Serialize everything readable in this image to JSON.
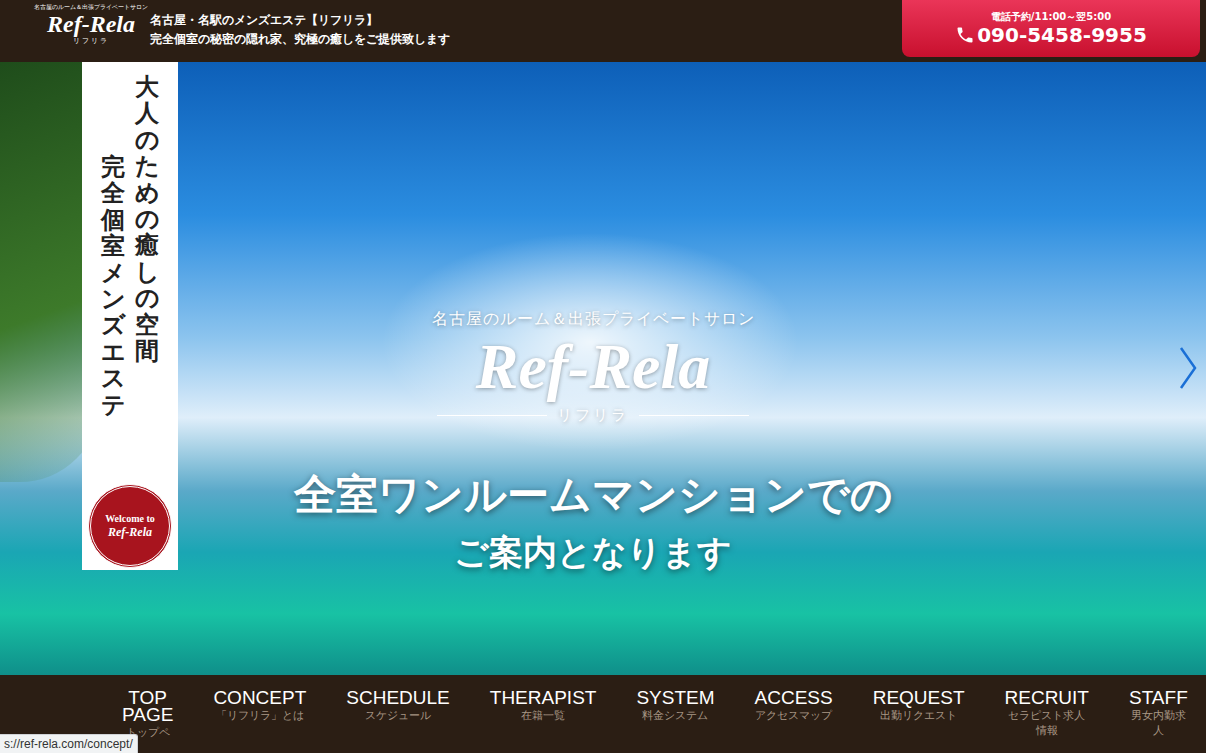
{
  "header": {
    "logo": {
      "tagline": "名古屋のルーム＆出張プライベートサロン",
      "name": "Ref-Rela",
      "reading": "リフリラ"
    },
    "title": "名古屋・名駅のメンズエステ【リフリラ】",
    "subtitle": "完全個室の秘密の隠れ家、究極の癒しをご提供致します",
    "phone": {
      "hours": "電話予約/11:00～翌5:00",
      "number": "090-5458-9955"
    }
  },
  "hero": {
    "vertical_lines": [
      "大人のための癒しの空間",
      "完全個室メンズエステ"
    ],
    "stamp": {
      "top": "Welcome to",
      "name": "Ref-Rela"
    },
    "tagline": "名古屋のルーム＆出張プライベートサロン",
    "name": "Ref-Rela",
    "reading": "リフリラ",
    "headline": "全室ワンルームマンションでの",
    "subline": "ご案内となります"
  },
  "nav": [
    {
      "label": "TOP PAGE",
      "sub": "トップペ"
    },
    {
      "label": "CONCEPT",
      "sub": "「リフリラ」とは"
    },
    {
      "label": "SCHEDULE",
      "sub": "スケジュール"
    },
    {
      "label": "THERAPIST",
      "sub": "在籍一覧"
    },
    {
      "label": "SYSTEM",
      "sub": "料金システム"
    },
    {
      "label": "ACCESS",
      "sub": "アクセスマップ"
    },
    {
      "label": "REQUEST",
      "sub": "出勤リクエスト"
    },
    {
      "label": "RECRUIT",
      "sub": "セラピスト求人情報"
    },
    {
      "label": "STAFF",
      "sub": "男女内勤求人"
    }
  ],
  "status_bar": {
    "url": "s://ref-rela.com/concept/"
  }
}
